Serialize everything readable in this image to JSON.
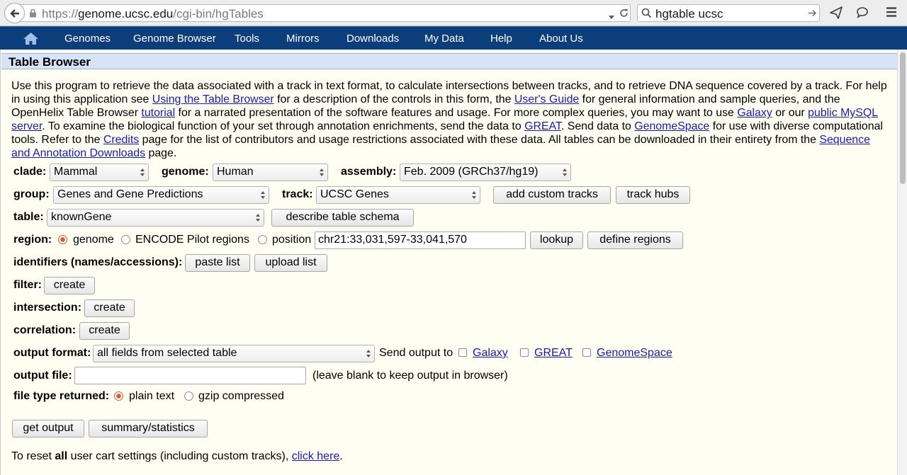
{
  "browser": {
    "url_prefix": "https://",
    "url_host": "genome.ucsc.edu",
    "url_path": "/cgi-bin/hgTables",
    "search_value": "hgtable ucsc"
  },
  "nav": {
    "items": [
      "Genomes",
      "Genome Browser",
      "Tools",
      "Mirrors",
      "Downloads",
      "My Data",
      "Help",
      "About Us"
    ]
  },
  "page": {
    "title": "Table Browser",
    "intro": [
      {
        "t": "Use this program to retrieve the data associated with a track in text format, to calculate intersections between tracks, and to retrieve DNA sequence covered by a track. For help in using this application see "
      },
      {
        "a": "Using the Table Browser"
      },
      {
        "t": " for a description of the controls in this form, the "
      },
      {
        "a": "User's Guide"
      },
      {
        "t": " for general information and sample queries, and the OpenHelix Table Browser "
      },
      {
        "a": "tutorial"
      },
      {
        "t": " for a narrated presentation of the software features and usage. For more complex queries, you may want to use "
      },
      {
        "a": "Galaxy"
      },
      {
        "t": " or our "
      },
      {
        "a": "public MySQL server"
      },
      {
        "t": ". To examine the biological function of your set through annotation enrichments, send the data to "
      },
      {
        "a": "GREAT"
      },
      {
        "t": ". Send data to "
      },
      {
        "a": "GenomeSpace"
      },
      {
        "t": " for use with diverse computational tools. Refer to the "
      },
      {
        "a": "Credits"
      },
      {
        "t": " page for the list of contributors and usage restrictions associated with these data. All tables can be downloaded in their entirety from the "
      },
      {
        "a": "Sequence and Annotation Downloads"
      },
      {
        "t": " page."
      }
    ]
  },
  "form": {
    "clade_label": "clade:",
    "clade_value": "Mammal",
    "genome_label": "genome:",
    "genome_value": "Human",
    "assembly_label": "assembly:",
    "assembly_value": "Feb. 2009 (GRCh37/hg19)",
    "group_label": "group:",
    "group_value": "Genes and Gene Predictions",
    "track_label": "track:",
    "track_value": "UCSC Genes",
    "add_custom_tracks": "add custom tracks",
    "track_hubs": "track hubs",
    "table_label": "table:",
    "table_value": "knownGene",
    "describe_schema": "describe table schema",
    "region_label": "region:",
    "region_genome": "genome",
    "region_encode": "ENCODE Pilot regions",
    "region_position": "position",
    "position_value": "chr21:33,031,597-33,041,570",
    "lookup": "lookup",
    "define_regions": "define regions",
    "identifiers_label": "identifiers (names/accessions):",
    "paste_list": "paste list",
    "upload_list": "upload list",
    "filter_label": "filter:",
    "filter_create": "create",
    "intersection_label": "intersection:",
    "intersection_create": "create",
    "correlation_label": "correlation:",
    "correlation_create": "create",
    "output_format_label": "output format:",
    "output_format_value": "all fields from selected table",
    "send_output_to": "Send output to",
    "send_galaxy": "Galaxy",
    "send_great": "GREAT",
    "send_genomespace": "GenomeSpace",
    "output_file_label": "output file:",
    "output_file_value": "",
    "output_file_hint": "(leave blank to keep output in browser)",
    "file_type_label": "file type returned:",
    "file_type_plain": "plain text",
    "file_type_gzip": "gzip compressed",
    "get_output": "get output",
    "summary_statistics": "summary/statistics",
    "reset_prefix": "To reset ",
    "reset_bold": "all",
    "reset_middle": " user cart settings (including custom tracks), ",
    "reset_link": "click here",
    "reset_suffix": "."
  },
  "colors": {
    "nav_bg": "#0c3e7c",
    "page_bg": "#fffef2",
    "title_bg": "#d7e3f6",
    "link": "#1a1ab0"
  }
}
